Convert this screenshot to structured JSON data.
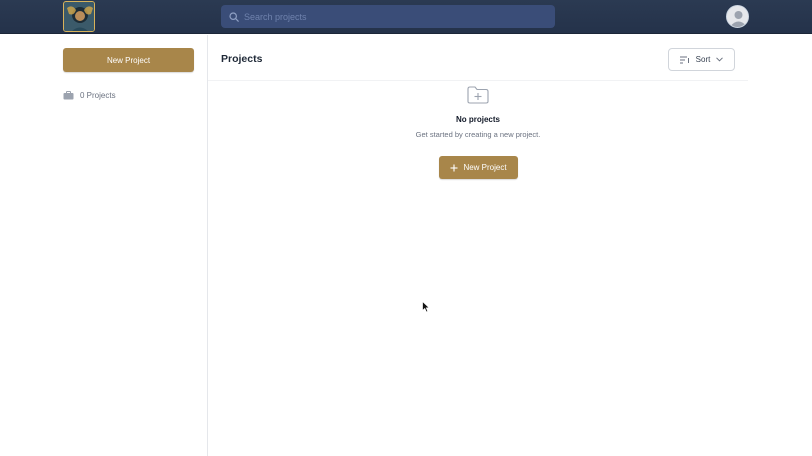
{
  "header": {
    "logo_icon": "portrait-logo-icon",
    "search": {
      "placeholder": "Search projects",
      "value": ""
    },
    "avatar_icon": "user-avatar-icon"
  },
  "sidebar": {
    "new_project_label": "New Project",
    "project_count_label": "0 Projects",
    "project_count_icon": "briefcase-icon"
  },
  "main": {
    "title": "Projects",
    "sort": {
      "label": "Sort",
      "icon": "sort-lines-icon",
      "chevron": "chevron-down-icon"
    },
    "empty_state": {
      "icon": "folder-plus-icon",
      "title": "No projects",
      "subtitle": "Get started by creating a new project.",
      "button_label": "New Project",
      "button_icon": "plus-icon"
    }
  },
  "colors": {
    "topbar": "#2b3a52",
    "search_bg": "#3a4d78",
    "accent": "#a8864a"
  }
}
